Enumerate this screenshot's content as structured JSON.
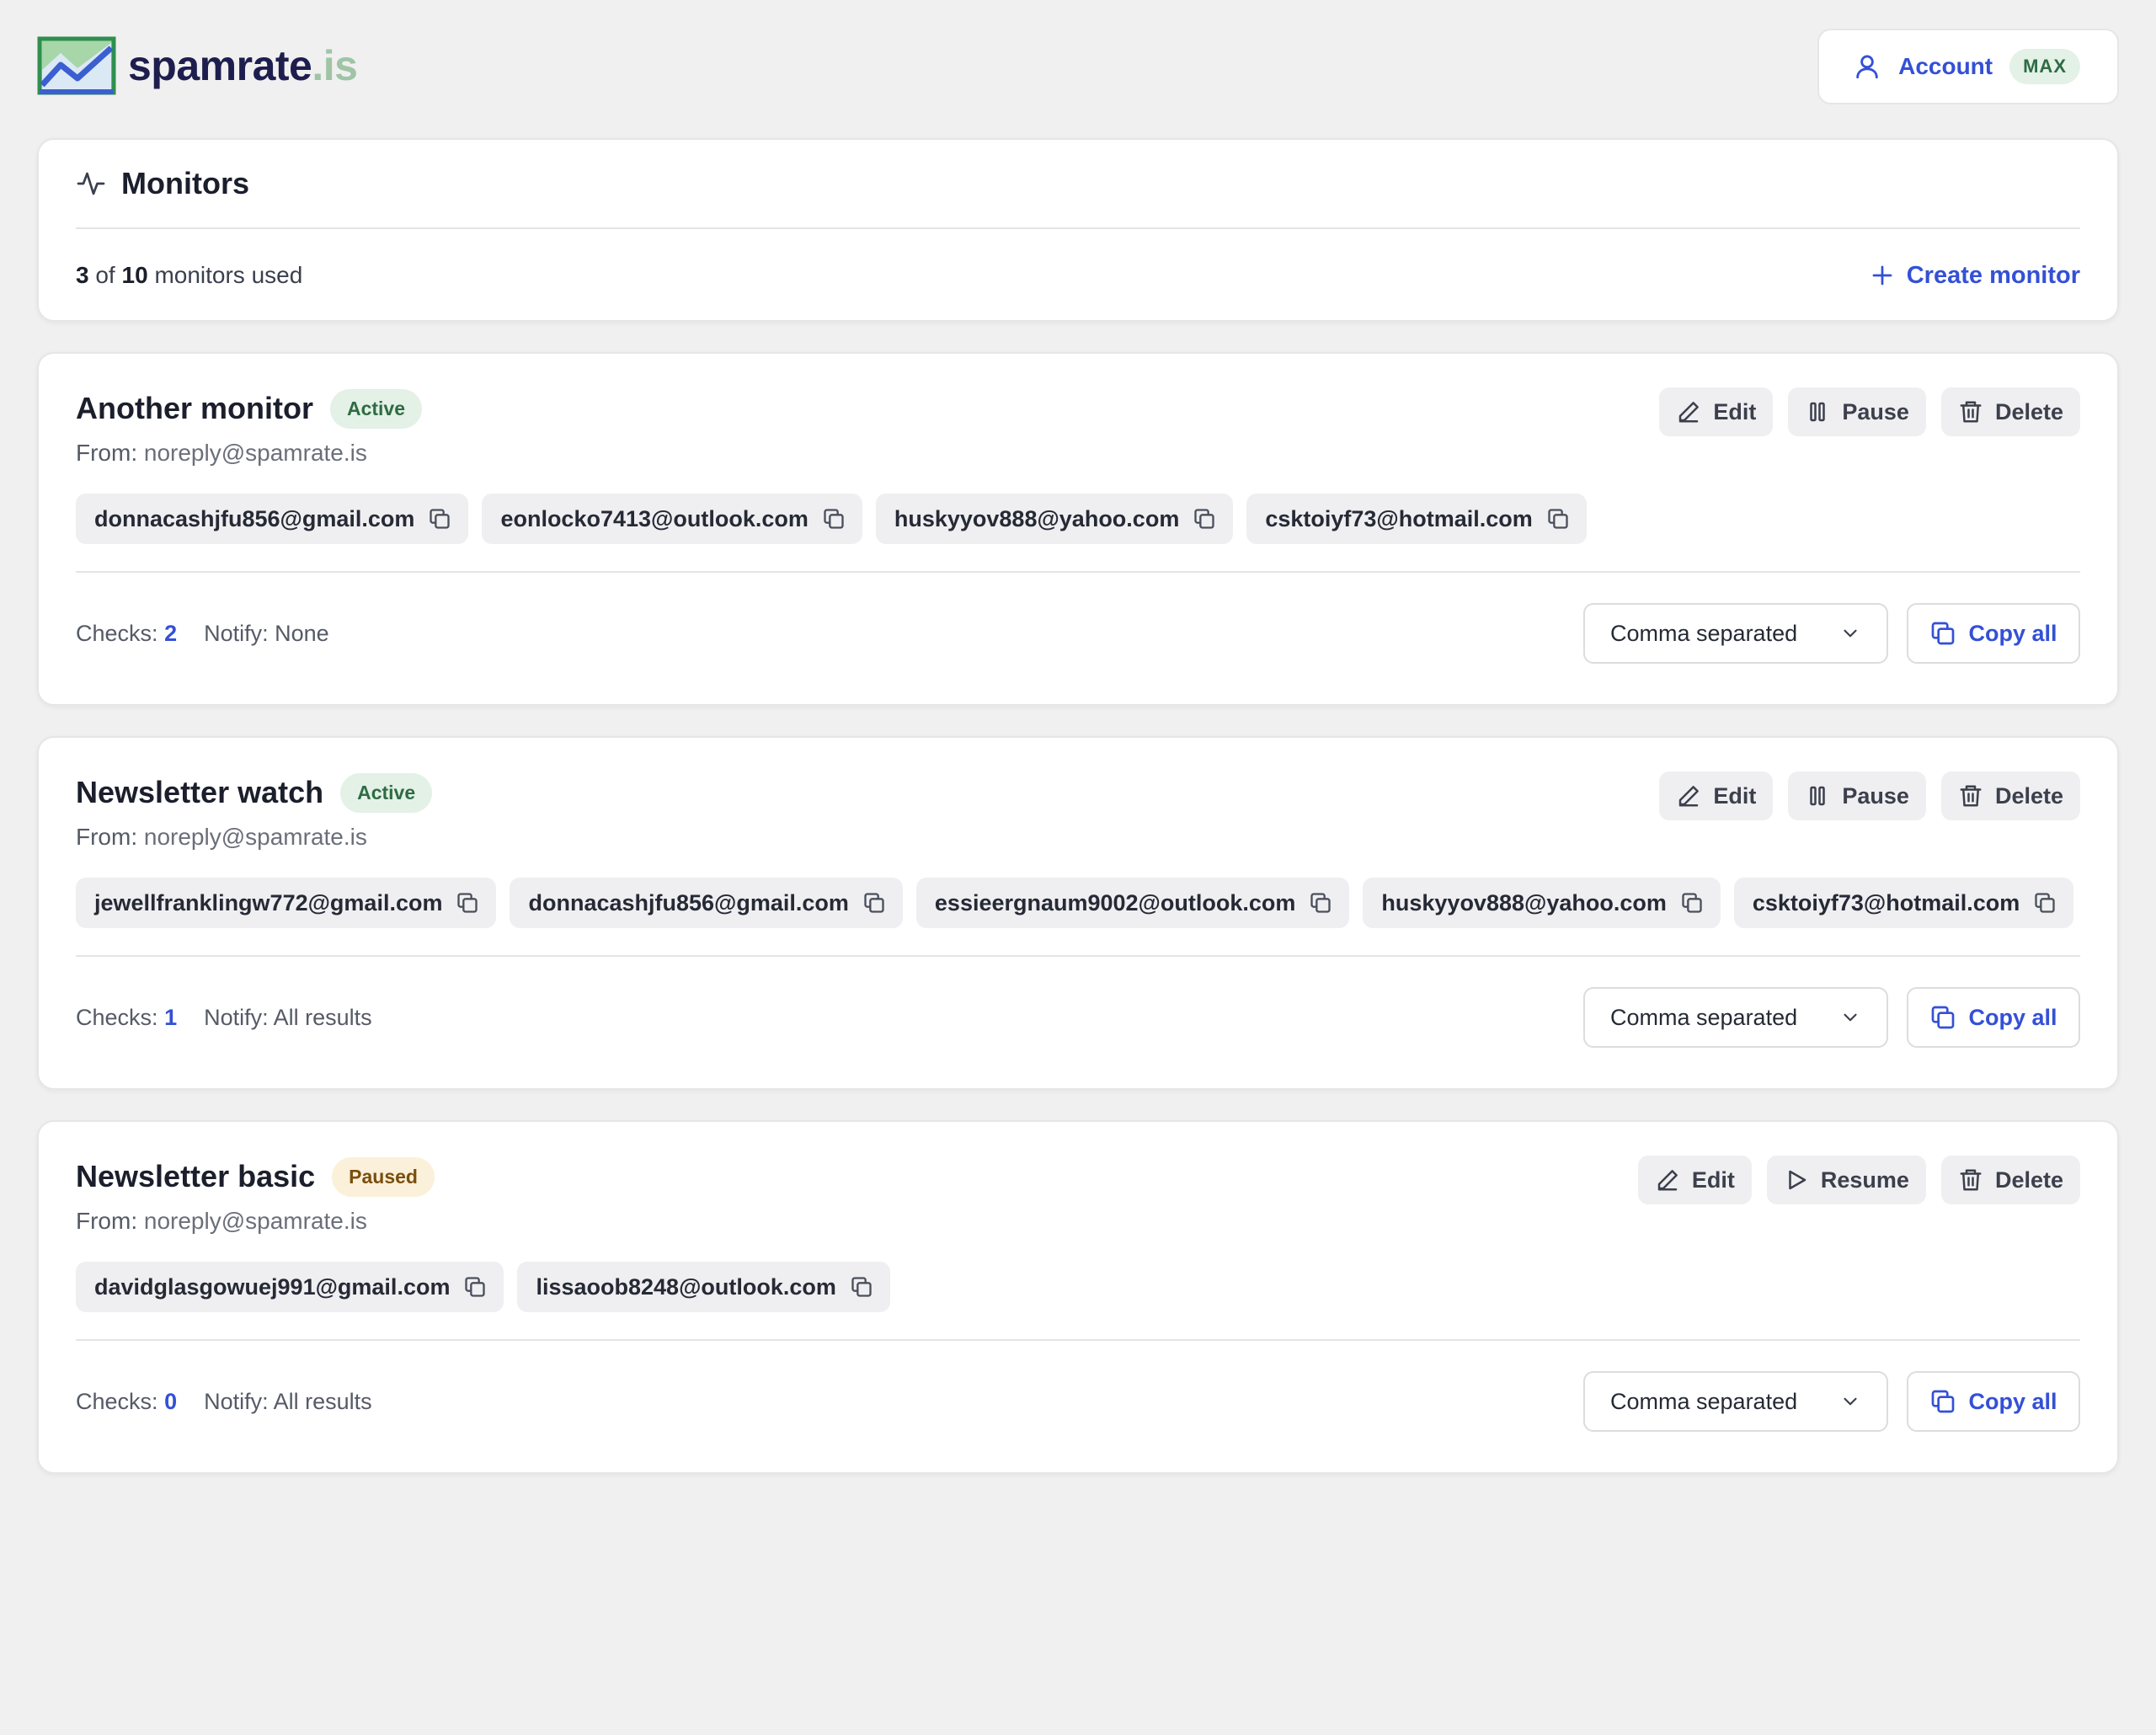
{
  "brand": {
    "name": "spamrate",
    "tld": ".is",
    "colors": {
      "name": "#1e1e4e",
      "tld": "#9fc4a6",
      "accent": "#3450d6"
    }
  },
  "account": {
    "label": "Account",
    "plan_badge": "MAX",
    "icon": "user-icon"
  },
  "summary": {
    "title": "Monitors",
    "used": "3",
    "of_label": "of",
    "total": "10",
    "suffix": "monitors used",
    "create_label": "Create monitor"
  },
  "labels": {
    "edit": "Edit",
    "pause": "Pause",
    "resume": "Resume",
    "delete": "Delete",
    "from": "From:",
    "checks": "Checks:",
    "notify": "Notify:",
    "format": "Comma separated",
    "copy_all": "Copy all"
  },
  "monitors": [
    {
      "name": "Another monitor",
      "status": "Active",
      "from": "noreply@spamrate.is",
      "recipients": [
        "donnacashjfu856@gmail.com",
        "eonlocko7413@outlook.com",
        "huskyyov888@yahoo.com",
        "csktoiyf73@hotmail.com"
      ],
      "checks": "2",
      "notify": "None"
    },
    {
      "name": "Newsletter watch",
      "status": "Active",
      "from": "noreply@spamrate.is",
      "recipients": [
        "jewellfranklingw772@gmail.com",
        "donnacashjfu856@gmail.com",
        "essieergnaum9002@outlook.com",
        "huskyyov888@yahoo.com",
        "csktoiyf73@hotmail.com"
      ],
      "checks": "1",
      "notify": "All results"
    },
    {
      "name": "Newsletter basic",
      "status": "Paused",
      "from": "noreply@spamrate.is",
      "recipients": [
        "davidglasgowuej991@gmail.com",
        "lissaoob8248@outlook.com"
      ],
      "checks": "0",
      "notify": "All results"
    }
  ]
}
